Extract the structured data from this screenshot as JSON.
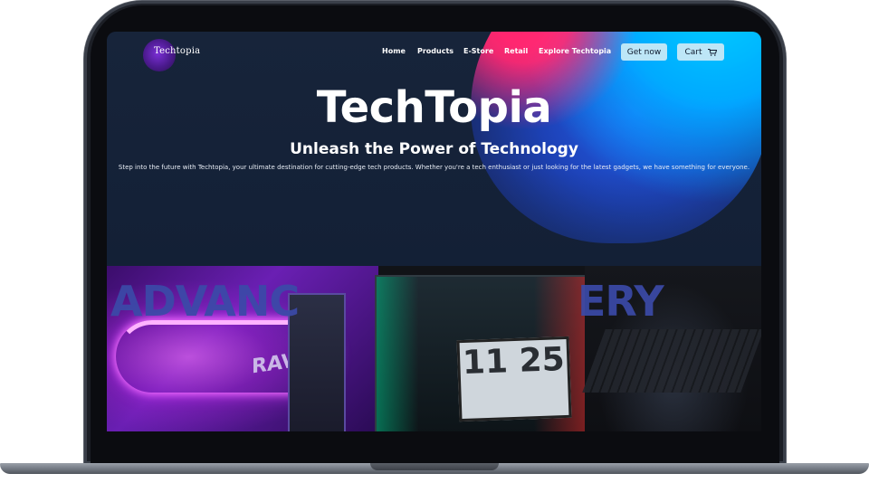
{
  "site": {
    "logo_text": "Techtopia"
  },
  "nav": {
    "links": [
      "Home",
      "Products",
      "E-Store",
      "Retail",
      "Explore Techtopia"
    ],
    "get_now_label": "Get now",
    "cart_label": "Cart"
  },
  "hero": {
    "title": "TechTopia",
    "subtitle": "Unleash the Power of Technology",
    "description": "Step into the future with Techtopia, your ultimate destination for cutting-edge tech products. Whether you're a tech enthusiast or just looking for the latest gadgets, we have something for everyone."
  },
  "gallery": {
    "word_left": "ADVANC",
    "word_right": "ERY",
    "device_text": "RAV",
    "clock_text": "11 25"
  },
  "colors": {
    "accent_button": "#bde6f7",
    "hero_bg": "#17243a",
    "blob_pink": "#ff2d6b",
    "blob_cyan": "#00c8ff"
  },
  "icons": {
    "cart": "cart-icon"
  }
}
